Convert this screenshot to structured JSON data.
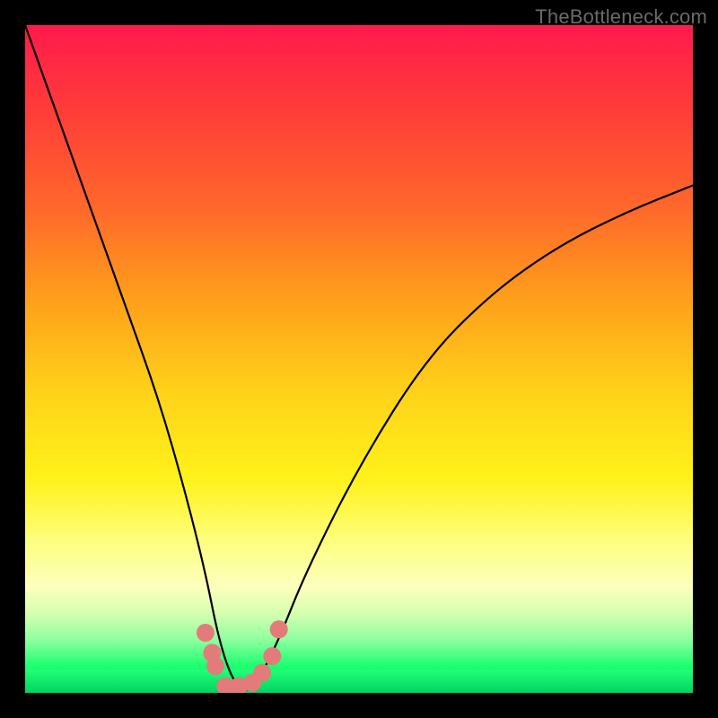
{
  "watermark": "TheBottleneck.com",
  "chart_data": {
    "type": "line",
    "title": "",
    "xlabel": "",
    "ylabel": "",
    "xlim": [
      0,
      100
    ],
    "ylim": [
      0,
      100
    ],
    "grid": false,
    "legend": false,
    "background_gradient": {
      "direction": "vertical",
      "meaning": "bottleneck severity (top red = severe, bottom green = balanced)",
      "stops": [
        {
          "pos": 0.0,
          "color": "#ff1a4d"
        },
        {
          "pos": 0.5,
          "color": "#ffd21a"
        },
        {
          "pos": 0.85,
          "color": "#fdffbd"
        },
        {
          "pos": 1.0,
          "color": "#00d460"
        }
      ]
    },
    "series": [
      {
        "name": "bottleneck-curve",
        "stroke": "#000000",
        "x": [
          0,
          5,
          10,
          15,
          20,
          24,
          27,
          29,
          31,
          33,
          35,
          38,
          42,
          50,
          60,
          70,
          80,
          90,
          100
        ],
        "y": [
          100,
          86,
          72,
          58,
          44,
          30,
          18,
          8,
          2,
          0,
          2,
          8,
          18,
          34,
          50,
          60,
          67,
          72,
          76
        ]
      },
      {
        "name": "highlight-band",
        "stroke": "#e47b7b",
        "note": "salmon dots marking the balanced region near the valley",
        "x": [
          27.0,
          28.0,
          28.5,
          30.0,
          32.0,
          34.0,
          35.5,
          37.0,
          38.0
        ],
        "y": [
          9.0,
          6.0,
          4.0,
          1.0,
          1.0,
          1.5,
          3.0,
          5.5,
          9.5
        ]
      }
    ]
  }
}
